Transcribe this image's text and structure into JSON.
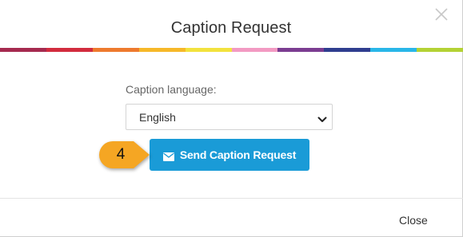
{
  "dialog": {
    "title": "Caption Request",
    "close_icon": "close-x-icon"
  },
  "stripe_colors": [
    "#a52a4f",
    "#d22c3e",
    "#ee7a2e",
    "#f6b829",
    "#f2e23e",
    "#f29ac2",
    "#7b3d91",
    "#2f3e8f",
    "#29b6e8",
    "#b4d235"
  ],
  "form": {
    "language_label": "Caption language:",
    "language_value": "English"
  },
  "actions": {
    "send_label": "Send Caption Request",
    "send_icon": "envelope-icon",
    "close_label": "Close"
  },
  "callout": {
    "number": "4",
    "color": "#f5a623"
  },
  "colors": {
    "primary_button": "#1a9bd7"
  }
}
